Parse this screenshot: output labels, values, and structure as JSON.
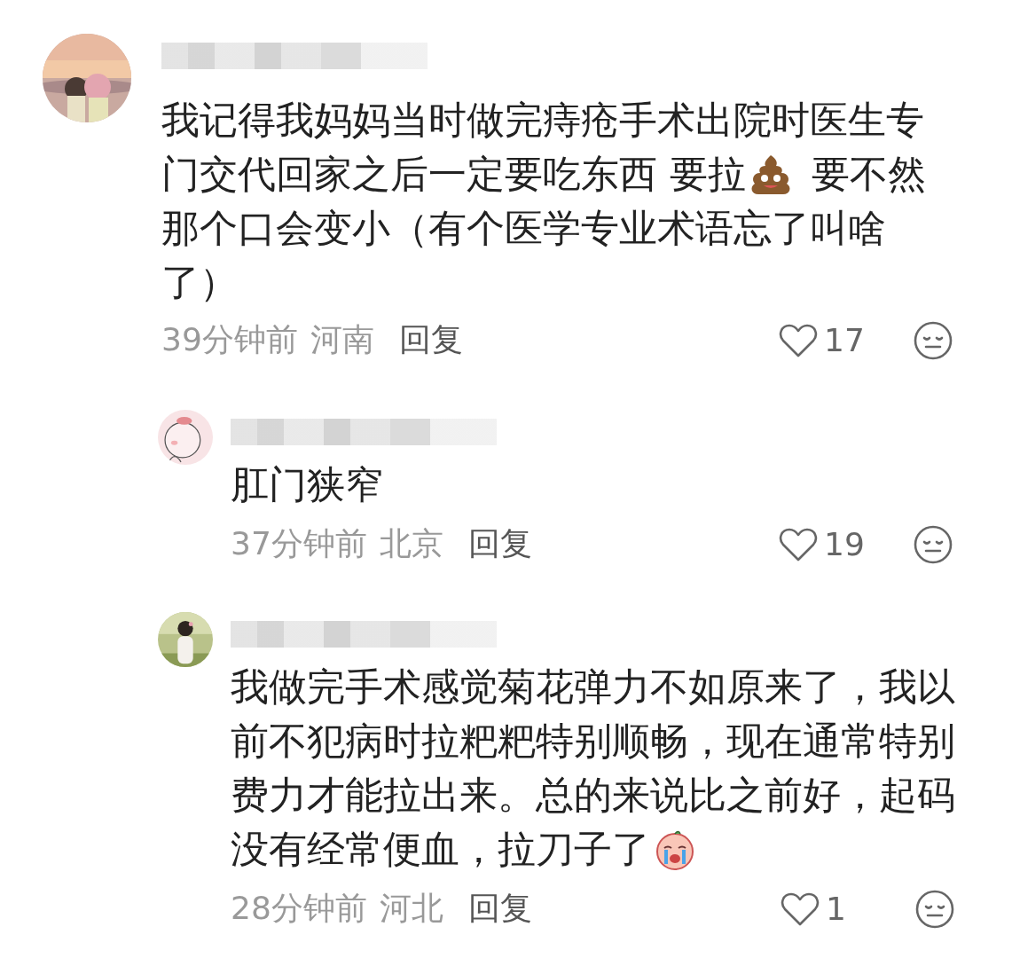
{
  "comments": [
    {
      "kind": "top",
      "lines": [
        [
          {
            "kind": "text",
            "text": "我记得我妈妈当时做完痔疮手术出院时医生专"
          }
        ],
        [
          {
            "kind": "text",
            "text": "门交代回家之后一定要吃东西 要拉"
          },
          {
            "kind": "poop_emoji"
          },
          {
            "kind": "text",
            "text": "要不然"
          }
        ],
        [
          {
            "kind": "text",
            "text": "那个口会变小（有个医学专业术语忘了叫啥"
          }
        ],
        [
          {
            "kind": "text",
            "text": "了）"
          }
        ]
      ],
      "time": "39分钟前",
      "location": "河南",
      "reply": "回复",
      "likes": "17"
    },
    {
      "kind": "reply",
      "lines": [
        [
          {
            "kind": "text",
            "text": "肛门狭窄"
          }
        ]
      ],
      "time": "37分钟前",
      "location": "北京",
      "reply": "回复",
      "likes": "19"
    },
    {
      "kind": "reply",
      "lines": [
        [
          {
            "kind": "text",
            "text": "我做完手术感觉菊花弹力不如原来了，我以"
          }
        ],
        [
          {
            "kind": "text",
            "text": "前不犯病时拉粑粑特别顺畅，现在通常特别"
          }
        ],
        [
          {
            "kind": "text",
            "text": "费力才能拉出来。总的来说比之前好，起码"
          }
        ],
        [
          {
            "kind": "text",
            "text": "没有经常便血，拉刀子了"
          },
          {
            "kind": "crying_emoji"
          }
        ]
      ],
      "time": "28分钟前",
      "location": "河北",
      "reply": "回复",
      "likes": "1"
    }
  ]
}
